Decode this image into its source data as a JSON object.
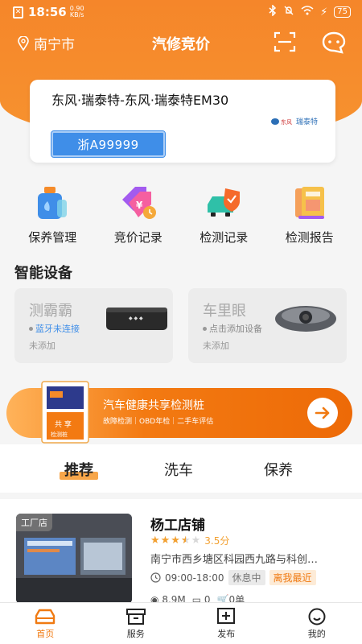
{
  "status_bar": {
    "time": "18:56",
    "speed_value": "0.90",
    "speed_unit": "KB/s",
    "battery": "75"
  },
  "header": {
    "city": "南宁市",
    "title": "汽修竞价"
  },
  "car": {
    "name": "东风·瑞泰特-东风·瑞泰特EM30",
    "brand_logo_text": "瑞泰特",
    "plate": "浙A99999"
  },
  "quick_actions": [
    {
      "label": "保养管理",
      "icon": "oil-can-icon"
    },
    {
      "label": "竞价记录",
      "icon": "price-tag-icon"
    },
    {
      "label": "检测记录",
      "icon": "car-shield-icon"
    },
    {
      "label": "检测报告",
      "icon": "report-book-icon"
    }
  ],
  "smart_devices": {
    "title": "智能设备",
    "items": [
      {
        "name": "测霸霸",
        "status": "蓝牙未连接",
        "sub": "未添加"
      },
      {
        "name": "车里眼",
        "status": "点击添加设备",
        "sub": "未添加"
      }
    ]
  },
  "banner": {
    "title": "汽车健康共享检测桩",
    "subtitle": "故障检测｜OBD年检｜二手车评估",
    "kiosk_text": "共享检测桩"
  },
  "tabs": [
    {
      "label": "推荐",
      "active": true
    },
    {
      "label": "洗车"
    },
    {
      "label": "保养"
    }
  ],
  "shop": {
    "badge": "工厂店",
    "name": "杨工店铺",
    "rating": "3.5分",
    "rating_value": 3.5,
    "address": "南宁市西乡塘区科园西九路与科创…",
    "hours": "09:00-18:00",
    "status_tag": "休息中",
    "distance_tag": "离我最近",
    "distance": "8.9M",
    "count1": "0",
    "count2": "0单"
  },
  "bottom_nav": [
    {
      "label": "首页",
      "active": true
    },
    {
      "label": "服务"
    },
    {
      "label": "发布"
    },
    {
      "label": "我的"
    }
  ],
  "colors": {
    "accent": "#f5862a",
    "plate_blue": "#3f8ee8",
    "star": "#f2a031"
  }
}
